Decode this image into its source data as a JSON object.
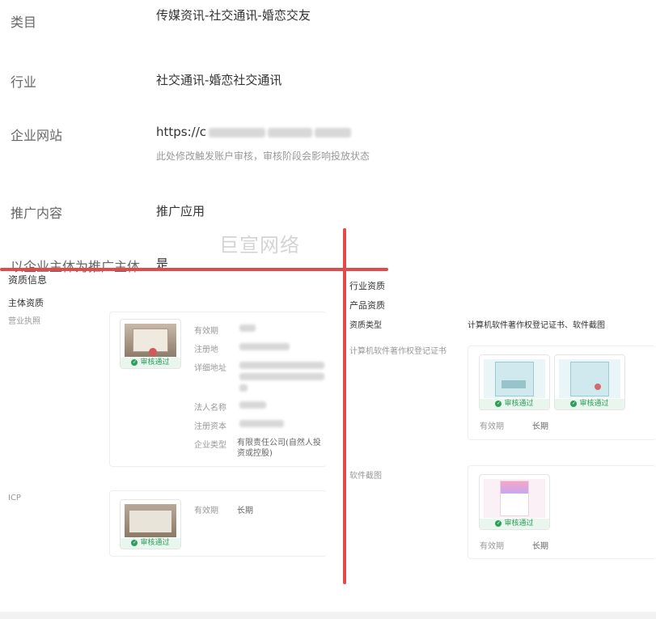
{
  "info_rows": [
    {
      "label": "类目",
      "value": "传媒资讯-社交通讯-婚恋交友"
    },
    {
      "label": "行业",
      "value": "社交通讯-婚恋社交通讯"
    },
    {
      "label": "企业网站",
      "value": "https://c",
      "hint": "此处修改触发账户审核，审核阶段会影响投放状态"
    },
    {
      "label": "推广内容",
      "value": "推广应用"
    },
    {
      "label": "以企业主体为推广主体",
      "value": "是"
    }
  ],
  "watermark": "巨宣网络",
  "qualification": {
    "title": "资质信息",
    "subject_title": "主体资质",
    "license_label": "营业执照",
    "license_fields": [
      "有效期",
      "注册地",
      "详细地址",
      "法人名称",
      "注册资本",
      "企业类型"
    ],
    "company_type": "有限责任公司(自然人投资或控股)",
    "icp_label": "ICP",
    "icp_validity_key": "有效期",
    "icp_validity_val": "长期"
  },
  "industry": {
    "title": "行业资质",
    "product_title": "产品资质",
    "type_key": "资质类型",
    "type_val": "计算机软件著作权登记证书、软件截图",
    "cert_label": "计算机软件著作权登记证书",
    "cert_validity_key": "有效期",
    "cert_validity_val": "长期",
    "screenshot_label": "软件截图",
    "screenshot_validity_key": "有效期",
    "screenshot_validity_val": "长期"
  },
  "badge_text": "审核通过",
  "colors": {
    "accent_red": "#e24b4b",
    "approved_green": "#2e9e5b"
  }
}
